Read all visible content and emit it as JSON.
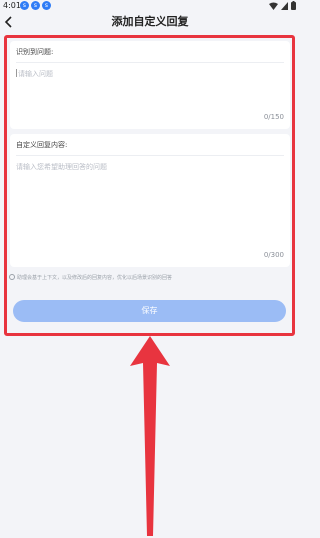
{
  "status": {
    "time": "4:01",
    "apps": [
      "s",
      "s",
      "s"
    ]
  },
  "header": {
    "back_icon": "back-arrow",
    "title": "添加自定义回复"
  },
  "question_card": {
    "label": "识别到问题:",
    "placeholder": "请输入问题",
    "counter": "0/150"
  },
  "reply_card": {
    "label": "自定义回复内容:",
    "placeholder": "请输入您希望助理回答的问题",
    "counter": "0/300"
  },
  "hint": "助理会基于上下文，以及修改后的回复内容，优化以后场景识别的回答",
  "save_button": {
    "label": "保存"
  },
  "colors": {
    "highlight": "#e8343f",
    "button": "#9bbcf5",
    "background": "#f3f4f8"
  }
}
